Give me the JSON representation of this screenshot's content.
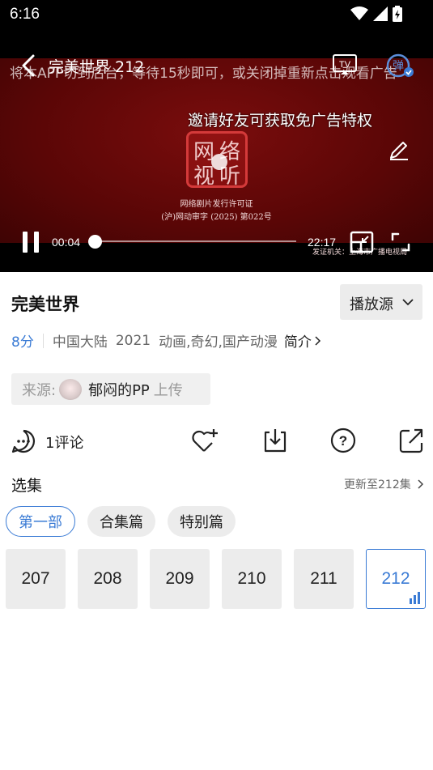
{
  "status_bar": {
    "time": "6:16"
  },
  "player": {
    "title": "完美世界 212",
    "marquee": "将本APP切到后台，等待15秒即可，或关闭掉重新点击观看广告",
    "invite_text": "邀请好友可获取免广告特权",
    "seal_chars": [
      "网",
      "络",
      "视",
      "听"
    ],
    "license_line1": "网络剧片发行许可证",
    "license_line2": "(沪)网动审字 (2025) 第022号",
    "issuer": "发证机关：上海市广播电视局",
    "current_time": "00:04",
    "total_time": "22:17",
    "progress": 0.003,
    "danmu_label": "弹"
  },
  "info": {
    "show_title": "完美世界",
    "source_button": "播放源",
    "score": "8分",
    "region": "中国大陆",
    "year": "2021",
    "genres": "动画,奇幻,国产动漫",
    "intro_link": "简介",
    "source_label": "来源:",
    "uploader": "郁闷的PP",
    "upload_suffix": "上传"
  },
  "actions": {
    "comment_count": "1评论"
  },
  "episodes": {
    "section_title": "选集",
    "update_info": "更新至212集",
    "tabs": [
      "第一部",
      "合集篇",
      "特别篇"
    ],
    "active_tab": 0,
    "items": [
      "207",
      "208",
      "209",
      "210",
      "211",
      "212"
    ],
    "active_item": 5
  },
  "colors": {
    "accent": "#3a7bd5",
    "player_red": "#6b0909",
    "chip_bg": "#ececec"
  }
}
